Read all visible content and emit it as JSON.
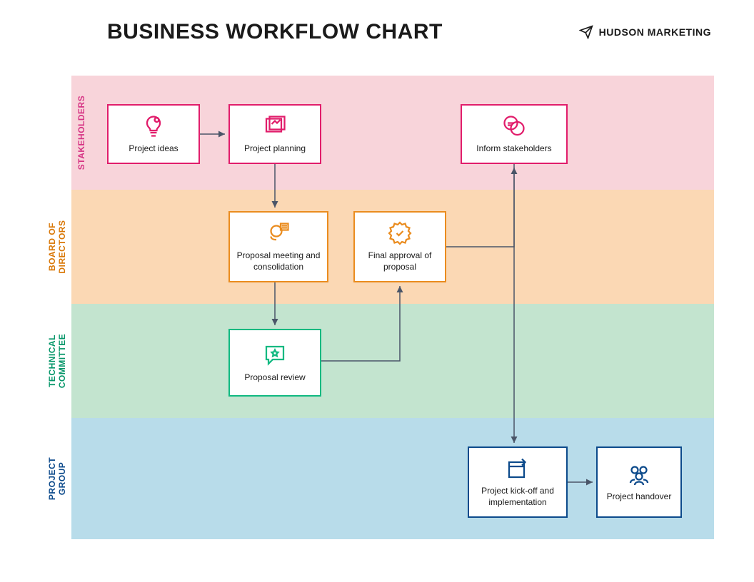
{
  "title": "BUSINESS WORKFLOW CHART",
  "brand": "HUDSON MARKETING",
  "lanes": {
    "stakeholders": "STAKEHOLDERS",
    "board": "BOARD OF\nDIRECTORS",
    "technical": "TECHNICAL\nCOMMITTEE",
    "project": "PROJECT\nGROUP"
  },
  "nodes": {
    "ideas": "Project ideas",
    "planning": "Project planning",
    "meeting": "Proposal meeting and consolidation",
    "approval": "Final approval of proposal",
    "review": "Proposal review",
    "inform": "Inform stakeholders",
    "kickoff": "Project kick-off and implementation",
    "handover": "Project handover"
  },
  "colors": {
    "stakeholders_bg": "#f8d4da",
    "board_bg": "#fbd8b4",
    "technical_bg": "#c3e4cf",
    "project_bg": "#b8dcea",
    "stakeholders_border": "#e11d6b",
    "board_border": "#ea8c1f",
    "technical_border": "#10b981",
    "project_border": "#0c4a8b",
    "arrow": "#4a5568"
  },
  "flow": [
    [
      "ideas",
      "planning"
    ],
    [
      "planning",
      "meeting"
    ],
    [
      "meeting",
      "review"
    ],
    [
      "review",
      "approval"
    ],
    [
      "approval",
      "inform"
    ],
    [
      "inform",
      "kickoff"
    ],
    [
      "kickoff",
      "handover"
    ]
  ]
}
